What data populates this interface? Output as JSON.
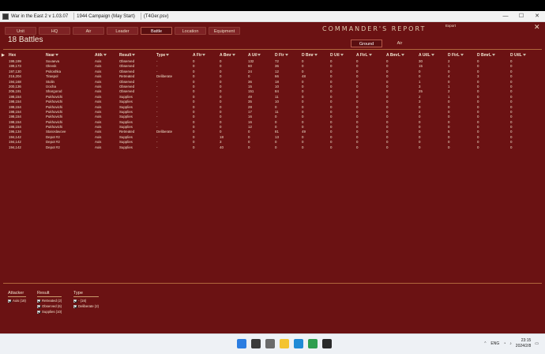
{
  "window": {
    "title": "War in the East 2  v 1.03.07",
    "doc_tab": "1944 Campaign (May Start)",
    "file": "(T4Ger.psv)"
  },
  "tabs": [
    "Unit",
    "HQ",
    "Air",
    "Leader",
    "Battle",
    "Location",
    "Equipment"
  ],
  "active_tab": "Battle",
  "report_title": "COMMANDER'S  REPORT",
  "export_label": "Export",
  "close_label": "✕",
  "battle_count": "18 Battles",
  "subtabs": [
    "Ground",
    "Air"
  ],
  "active_subtab": "Ground",
  "columns": [
    "Hex",
    "Near",
    "Attk",
    "Result",
    "Type",
    "A Ftr",
    "A Bmr",
    "A Utl",
    "D Ftr",
    "D Bmr",
    "D Utl",
    "A FtrL",
    "A BmrL",
    "A UtlL",
    "D FtrL",
    "D BmrL",
    "D UtlL"
  ],
  "rows": [
    [
      "199,199",
      "Suvaeva",
      "Axis",
      "Observed",
      "-",
      "0",
      "0",
      "132",
      "72",
      "0",
      "0",
      "0",
      "0",
      "30",
      "2",
      "0",
      "0"
    ],
    [
      "199,173",
      "Olevsk",
      "Axis",
      "Observed",
      "-",
      "0",
      "0",
      "60",
      "36",
      "0",
      "0",
      "0",
      "0",
      "15",
      "1",
      "0",
      "0"
    ],
    [
      "197,130",
      "Psitoshka",
      "Axis",
      "Observed",
      "-",
      "0",
      "0",
      "24",
      "12",
      "0",
      "0",
      "0",
      "0",
      "0",
      "0",
      "0",
      "0"
    ],
    [
      "216,204",
      "Tiraspol",
      "Axis",
      "Retreated",
      "Deliberate",
      "0",
      "0",
      "0",
      "66",
      "48",
      "0",
      "0",
      "0",
      "0",
      "4",
      "3",
      "0"
    ],
    [
      "194,168",
      "Stolin",
      "Axis",
      "Observed",
      "-",
      "0",
      "0",
      "36",
      "18",
      "0",
      "0",
      "0",
      "0",
      "1",
      "0",
      "0",
      "0"
    ],
    [
      "200,136",
      "Izocha",
      "Axis",
      "Observed",
      "-",
      "0",
      "0",
      "15",
      "10",
      "0",
      "0",
      "0",
      "0",
      "3",
      "1",
      "0",
      "0"
    ],
    [
      "206,191",
      "Shargorod",
      "Axis",
      "Observed",
      "-",
      "0",
      "0",
      "151",
      "84",
      "0",
      "0",
      "0",
      "0",
      "25",
      "2",
      "0",
      "0"
    ],
    [
      "198,154",
      "Pukhovichi",
      "Axis",
      "Supplies",
      "-",
      "0",
      "0",
      "49",
      "11",
      "0",
      "0",
      "0",
      "0",
      "2",
      "1",
      "0",
      "0"
    ],
    [
      "198,154",
      "Pukhovichi",
      "Axis",
      "Supplies",
      "-",
      "0",
      "0",
      "35",
      "10",
      "0",
      "0",
      "0",
      "0",
      "3",
      "0",
      "0",
      "0"
    ],
    [
      "198,154",
      "Pukhovichi",
      "Axis",
      "Supplies",
      "-",
      "0",
      "0",
      "28",
      "0",
      "0",
      "0",
      "0",
      "0",
      "0",
      "0",
      "0",
      "0"
    ],
    [
      "198,154",
      "Pukhovichi",
      "Axis",
      "Supplies",
      "-",
      "0",
      "0",
      "17",
      "11",
      "0",
      "0",
      "0",
      "0",
      "2",
      "0",
      "0",
      "0"
    ],
    [
      "198,154",
      "Pukhovichi",
      "Axis",
      "Supplies",
      "-",
      "0",
      "0",
      "16",
      "0",
      "0",
      "0",
      "0",
      "0",
      "0",
      "0",
      "0",
      "0"
    ],
    [
      "198,154",
      "Pukhovichi",
      "Axis",
      "Supplies",
      "-",
      "0",
      "0",
      "16",
      "0",
      "0",
      "0",
      "0",
      "0",
      "0",
      "0",
      "0",
      "0"
    ],
    [
      "198,154",
      "Pukhovichi",
      "Axis",
      "Supplies",
      "-",
      "0",
      "0",
      "12",
      "0",
      "0",
      "0",
      "0",
      "0",
      "0",
      "0",
      "0",
      "0"
    ],
    [
      "196,134",
      "Staroslavove",
      "Axis",
      "Retreated",
      "Deliberate",
      "0",
      "0",
      "0",
      "81",
      "49",
      "0",
      "0",
      "0",
      "0",
      "5",
      "0",
      "0"
    ],
    [
      "194,142",
      "Depot #2",
      "Axis",
      "Supplies",
      "-",
      "0",
      "18",
      "0",
      "13",
      "0",
      "0",
      "0",
      "0",
      "0",
      "0",
      "0",
      "0"
    ],
    [
      "194,142",
      "Depot #2",
      "Axis",
      "Supplies",
      "-",
      "0",
      "3",
      "0",
      "0",
      "0",
      "0",
      "0",
      "0",
      "0",
      "0",
      "0",
      "0"
    ],
    [
      "194,142",
      "Depot #2",
      "Axis",
      "Supplies",
      "-",
      "0",
      "40",
      "0",
      "0",
      "0",
      "0",
      "0",
      "0",
      "0",
      "0",
      "0",
      "0"
    ]
  ],
  "filters": {
    "attacker": {
      "title": "Attacker",
      "items": [
        "Axis (18)"
      ]
    },
    "result": {
      "title": "Result",
      "items": [
        "Retreated (2)",
        "Observed (6)",
        "Supplies (10)"
      ]
    },
    "type": {
      "title": "Type",
      "items": [
        "- (16)",
        "Deliberate (2)"
      ]
    }
  },
  "tray": {
    "lang": "ENG",
    "time": "23:15",
    "date": "2024/2/8"
  }
}
